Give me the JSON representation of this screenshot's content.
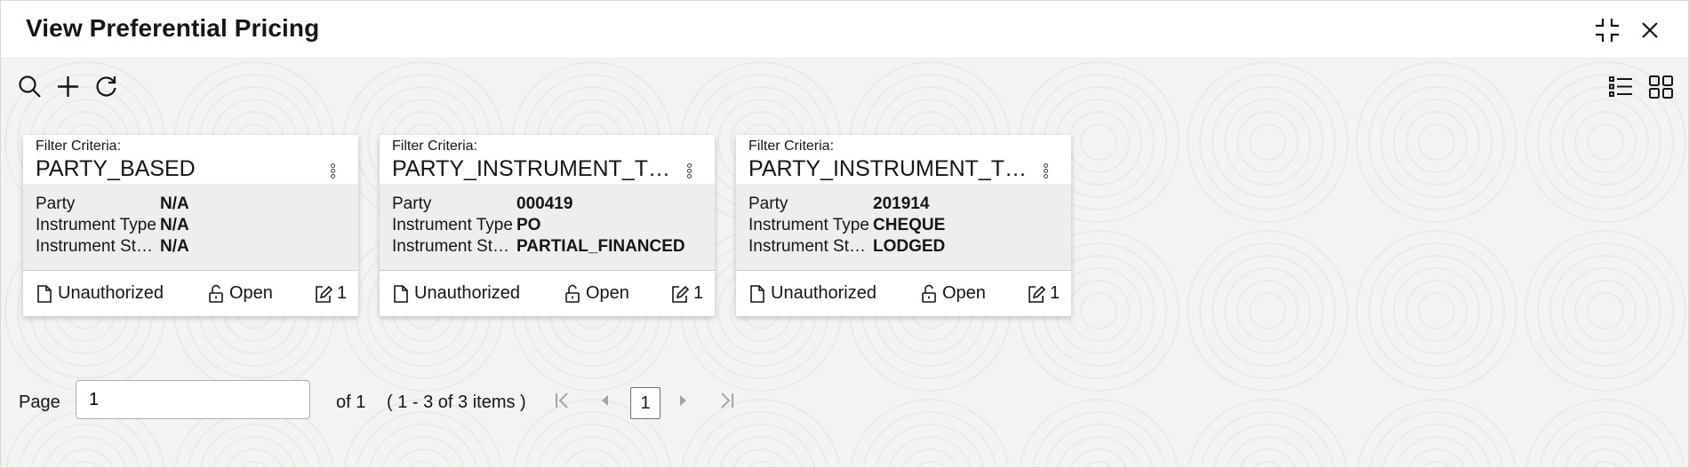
{
  "window": {
    "title": "View Preferential Pricing"
  },
  "pagination": {
    "page_label": "Page",
    "page_value": "1",
    "of_label": "of 1",
    "items_label": "( 1 - 3 of 3 items )",
    "current_page": "1"
  },
  "cards": [
    {
      "filter_label": "Filter Criteria:",
      "filter_value": "PARTY_BASED",
      "rows": [
        {
          "label": "Party",
          "value": "N/A"
        },
        {
          "label": "Instrument Type",
          "value": "N/A"
        },
        {
          "label": "Instrument Status",
          "value": "N/A"
        }
      ],
      "status": "Unauthorized",
      "lock": "Open",
      "version": "1"
    },
    {
      "filter_label": "Filter Criteria:",
      "filter_value": "PARTY_INSTRUMENT_TYPE_STATUS_BASED",
      "rows": [
        {
          "label": "Party",
          "value": "000419"
        },
        {
          "label": "Instrument Type",
          "value": "PO"
        },
        {
          "label": "Instrument Status",
          "value": "PARTIAL_FINANCED"
        }
      ],
      "status": "Unauthorized",
      "lock": "Open",
      "version": "1"
    },
    {
      "filter_label": "Filter Criteria:",
      "filter_value": "PARTY_INSTRUMENT_TYPE_STATUS_BASED",
      "rows": [
        {
          "label": "Party",
          "value": "201914"
        },
        {
          "label": "Instrument Type",
          "value": "CHEQUE"
        },
        {
          "label": "Instrument Status",
          "value": "LODGED"
        }
      ],
      "status": "Unauthorized",
      "lock": "Open",
      "version": "1"
    }
  ],
  "icons": {
    "header": [
      "collapse-icon",
      "close-icon"
    ],
    "toolbar": [
      "search-icon",
      "add-icon",
      "refresh-icon"
    ],
    "view": [
      "list-view-icon",
      "grid-view-icon"
    ]
  },
  "colors": {
    "text": "#161513",
    "card_body": "#eeeeee",
    "background": "#f4f3f1"
  }
}
